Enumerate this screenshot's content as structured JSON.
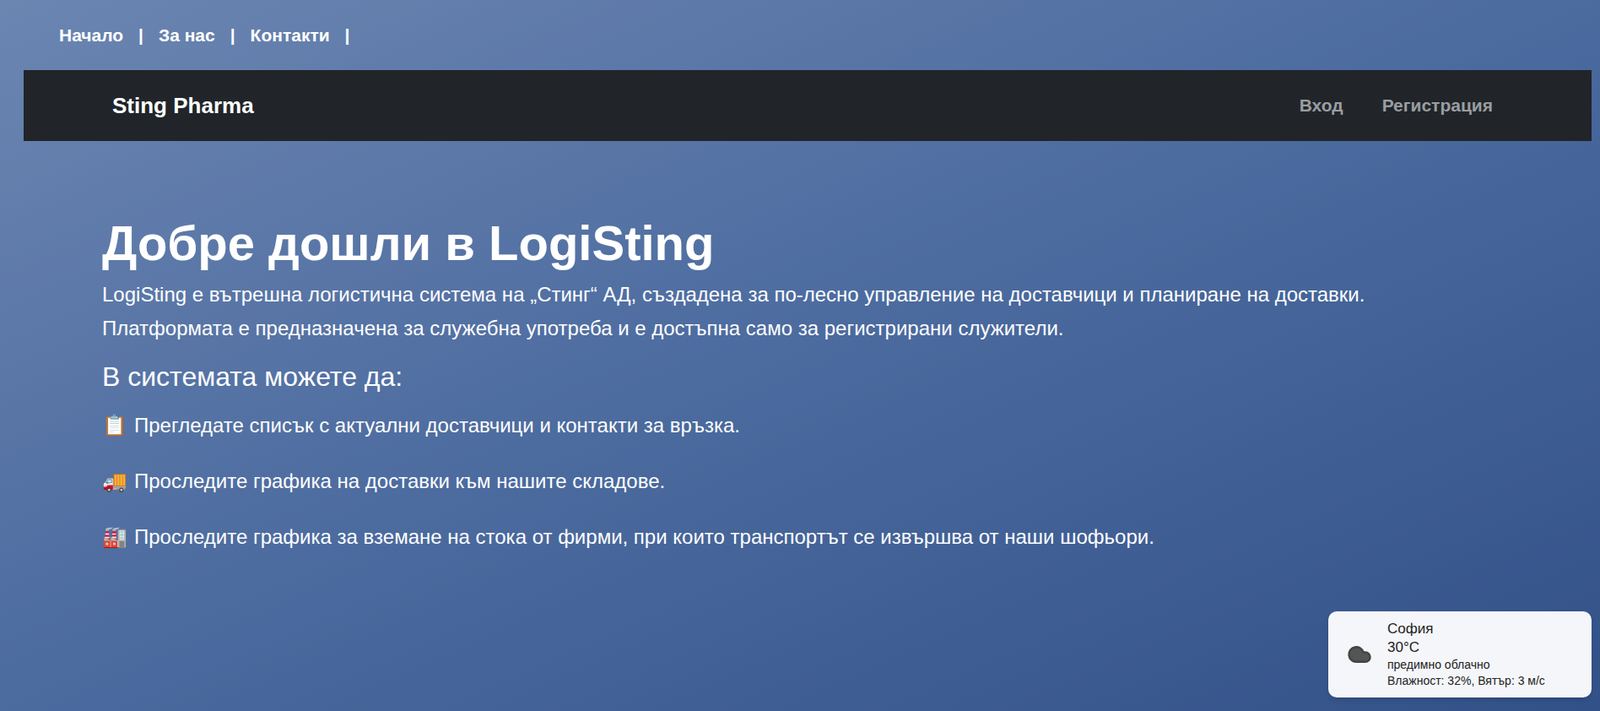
{
  "top_links": [
    {
      "label": "Начало",
      "separator": "|"
    },
    {
      "label": "За нас",
      "separator": "|"
    },
    {
      "label": "Контакти",
      "separator": "|"
    }
  ],
  "navbar": {
    "brand": "Sting Pharma",
    "links": [
      "Вход",
      "Регистрация"
    ]
  },
  "hero": {
    "title": "Добре дошли в LogiSting",
    "description": "LogiSting е вътрешна логистична система на „Стинг“ АД, създадена за по-лесно управление на доставчици и планиране на доставки. Платформата е предназначена за служебна употреба и е достъпна само за регистрирани служители.",
    "subtitle": "В системата можете да:",
    "features": [
      {
        "icon": "📋",
        "text": "Прегледате списък с актуални доставчици и контакти за връзка."
      },
      {
        "icon": "🚚",
        "text": "Проследите графика на доставки към нашите складове."
      },
      {
        "icon": "🏭",
        "text": "Проследите графика за вземане на стока от фирми, при които транспортът се извършва от наши шофьори."
      }
    ]
  },
  "weather": {
    "city": "София",
    "temperature": "30°C",
    "condition": "предимно облачно",
    "details": "Влажност: 32%, Вятър: 3 м/с"
  }
}
